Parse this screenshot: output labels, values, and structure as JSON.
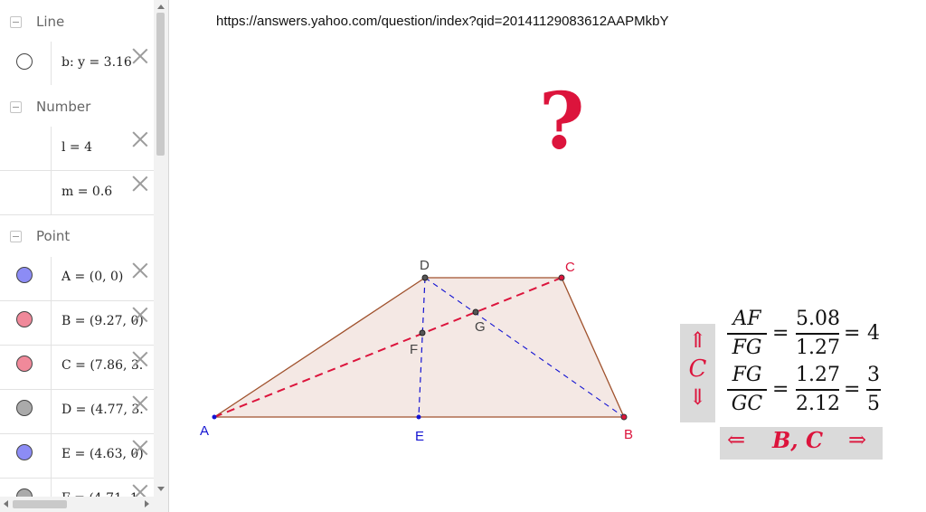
{
  "sidebar": {
    "groups": [
      {
        "label": "Line"
      },
      {
        "label": "Number"
      },
      {
        "label": "Point"
      }
    ],
    "line_items": [
      {
        "text": "b: y = 3.16",
        "marble_color": "#ffffff"
      }
    ],
    "number_items": [
      {
        "text": "l = 4"
      },
      {
        "text": "m = 0.6"
      }
    ],
    "point_items": [
      {
        "text": "A = (0, 0)",
        "marble_color": "#8c8cf5"
      },
      {
        "text": "B = (9.27, 0)",
        "marble_color": "#f0899a"
      },
      {
        "text": "C = (7.86, 3.",
        "marble_color": "#f0899a"
      },
      {
        "text": "D = (4.77, 3.",
        "marble_color": "#aaaaaa"
      },
      {
        "text": "E = (4.63, 0)",
        "marble_color": "#8c8cf5"
      },
      {
        "text": "F = (4.71, 1",
        "marble_color": "#aaaaaa"
      }
    ]
  },
  "graphics": {
    "url": "https://answers.yahoo.com/question/index?qid=20141129083612AAPMkbY",
    "question_mark": "?",
    "points": {
      "A": "A",
      "B": "B",
      "C": "C",
      "D": "D",
      "E": "E",
      "F": "F",
      "G": "G"
    },
    "colors": {
      "accent_red": "#dc143c",
      "blue": "#1414d2",
      "polygon_fill": "#f4e8e4",
      "polygon_edge": "#a0522d"
    }
  },
  "ratio_panel": {
    "row1": {
      "num": "AF",
      "den": "FG",
      "num_val": "5.08",
      "den_val": "1.27",
      "result": "4"
    },
    "row2": {
      "num": "FG",
      "den": "GC",
      "num_val": "1.27",
      "den_val": "2.12",
      "result_num": "3",
      "result_den": "5"
    },
    "eq": "=",
    "updown": {
      "up": "⇑",
      "letter": "C",
      "down": "⇓"
    },
    "bc_toggle": {
      "left": "⇐",
      "text": "B, C",
      "right": "⇒"
    }
  }
}
